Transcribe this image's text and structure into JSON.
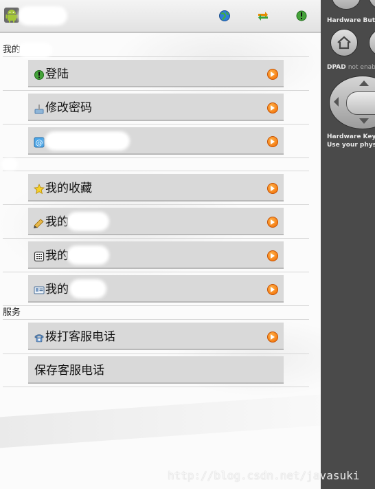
{
  "app": {
    "title": "",
    "colors": {
      "arrow": "#f26a00",
      "item_bg": "#d9d9d9",
      "panel_bg": "#4a4a4a"
    }
  },
  "toolbar": {
    "icons": [
      "globe-icon",
      "sync-arrows-icon",
      "info-icon"
    ]
  },
  "sections": [
    {
      "header": "我的",
      "items": [
        {
          "label": "登陆",
          "icon": "info-icon"
        },
        {
          "label": "修改密码",
          "icon": "key-icon"
        },
        {
          "label": "",
          "icon": "at-sign-icon"
        }
      ]
    },
    {
      "header": "",
      "items": [
        {
          "label": "我的收藏",
          "icon": "star-icon"
        },
        {
          "label": "我的",
          "icon": "pencil-icon"
        },
        {
          "label": "我的",
          "icon": "calculator-icon"
        },
        {
          "label": "我的",
          "icon": "id-card-icon"
        }
      ]
    },
    {
      "header": "服务",
      "items": [
        {
          "label": "拨打客服电话",
          "icon": "phone-icon"
        },
        {
          "label": "保存客服电话",
          "icon": ""
        }
      ]
    }
  ],
  "side_panel": {
    "hardware_buttons_label": "Hardware Butto",
    "dpad_label": "DPAD",
    "dpad_status": "not enabl",
    "keyboard_label": "Hardware Keybo",
    "keyboard_sub": "Use your physic"
  },
  "watermark": "http://blog.csdn.net/javasuki"
}
